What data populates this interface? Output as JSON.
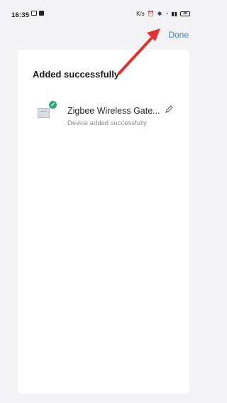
{
  "status_bar": {
    "time": "16:35",
    "right_text": "K/s",
    "battery": "48"
  },
  "header": {
    "done_label": "Done"
  },
  "result": {
    "title": "Added successfully",
    "device_name": "Zigbee Wireless Gate...",
    "device_status": "Device added successfully"
  },
  "icons": {
    "mail": "mail-icon",
    "square": "app-icon",
    "alarm": "alarm-icon",
    "bluetooth": "bluetooth-icon",
    "wifi": "wifi-icon",
    "signal": "signal-icon",
    "battery": "battery-icon",
    "edit": "pencil-icon",
    "device": "gateway-device-icon",
    "success": "check-icon",
    "annotation": "arrow-icon"
  },
  "colors": {
    "accent": "#3b84d8",
    "success": "#2aa976",
    "arrow": "#e2322d"
  }
}
